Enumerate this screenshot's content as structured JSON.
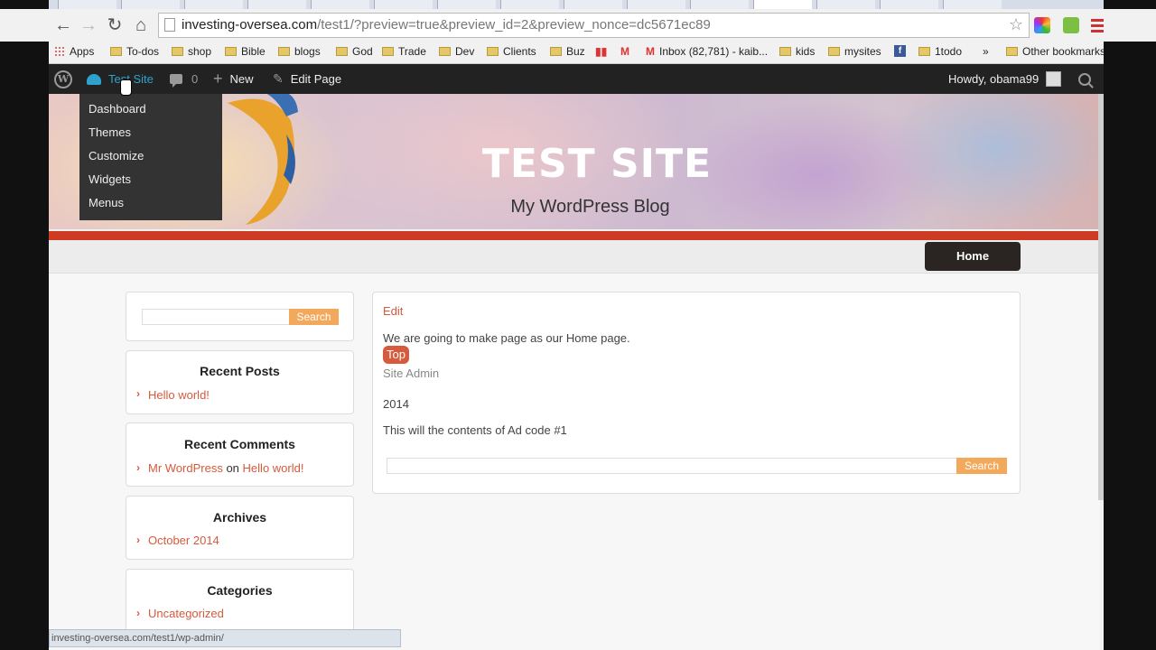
{
  "browser": {
    "url_host": "investing-oversea.com",
    "url_path": "/test1/?preview=true&preview_id=2&preview_nonce=dc5671ec89",
    "bookmarks": [
      "Apps",
      "To-dos",
      "shop",
      "Bible",
      "blogs",
      "God",
      "Trade",
      "Dev",
      "Clients",
      "Buz",
      "Inbox (82,781) - kaib...",
      "kids",
      "mysites",
      "1todo",
      "»",
      "Other bookmarks"
    ],
    "status_url": "investing-oversea.com/test1/wp-admin/"
  },
  "adminbar": {
    "site_name": "Test Site",
    "comments_count": "0",
    "new_label": "New",
    "edit_label": "Edit Page",
    "howdy": "Howdy, obama99"
  },
  "site_menu": [
    "Dashboard",
    "Themes",
    "Customize",
    "Widgets",
    "Menus"
  ],
  "header": {
    "title": "TEST SITE",
    "tagline": "My WordPress Blog"
  },
  "nav": {
    "home": "Home"
  },
  "sidebar": {
    "search_button": "Search",
    "recent_posts": {
      "title": "Recent Posts",
      "items": [
        "Hello world!"
      ]
    },
    "recent_comments": {
      "title": "Recent Comments",
      "author": "Mr WordPress",
      "on": "on",
      "post": "Hello world!"
    },
    "archives": {
      "title": "Archives",
      "items": [
        "October 2014"
      ]
    },
    "categories": {
      "title": "Categories",
      "items": [
        "Uncategorized"
      ]
    }
  },
  "main": {
    "edit": "Edit",
    "text": "We are going to make page as our Home page.",
    "tag": "Top",
    "author": "Site Admin",
    "year": "2014",
    "ad": "This will the contents of Ad code #1",
    "search_button": "Search"
  },
  "colors": {
    "accent": "#d65a3c",
    "search_button": "#f3a95b",
    "redbar": "#cc3b22",
    "adminbar": "#222222"
  }
}
